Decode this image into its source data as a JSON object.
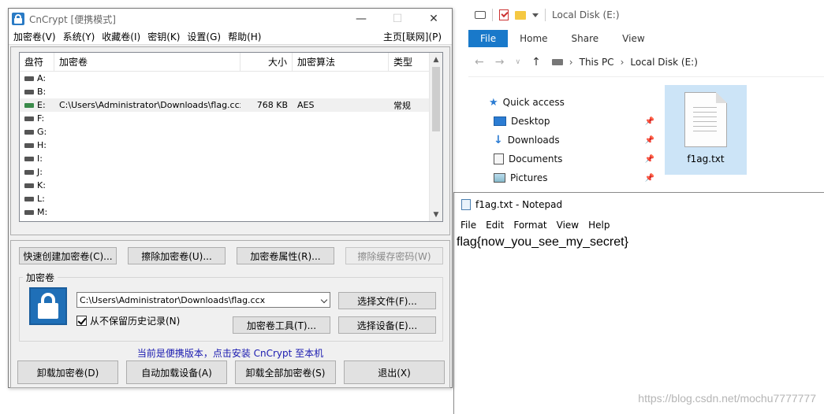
{
  "explorer": {
    "title": "Local Disk (E:)",
    "ribbon_tabs": [
      "File",
      "Home",
      "Share",
      "View"
    ],
    "address": [
      "This PC",
      "Local Disk (E:)"
    ],
    "nav_items": [
      "Quick access",
      "Desktop",
      "Downloads",
      "Documents",
      "Pictures"
    ],
    "file_name": "f1ag.txt"
  },
  "notepad": {
    "title": "f1ag.txt - Notepad",
    "menu": [
      "File",
      "Edit",
      "Format",
      "View",
      "Help"
    ],
    "content": "flag{now_you_see_my_secret}"
  },
  "watermark": "https://blog.csdn.net/mochu7777777",
  "cncrypt": {
    "title": "CnCrypt [便携模式]",
    "menu": [
      "加密卷(V)",
      "系统(Y)",
      "收藏卷(I)",
      "密钥(K)",
      "设置(G)",
      "帮助(H)"
    ],
    "menu_right": "主页[联网](P)",
    "columns": [
      "盘符",
      "加密卷",
      "大小",
      "加密算法",
      "类型"
    ],
    "drives": [
      {
        "letter": "A:",
        "volume": "",
        "size": "",
        "algo": "",
        "type": ""
      },
      {
        "letter": "B:",
        "volume": "",
        "size": "",
        "algo": "",
        "type": ""
      },
      {
        "letter": "E:",
        "volume": "C:\\Users\\Administrator\\Downloads\\flag.ccx",
        "size": "768 KB",
        "algo": "AES",
        "type": "常规"
      },
      {
        "letter": "F:",
        "volume": "",
        "size": "",
        "algo": "",
        "type": ""
      },
      {
        "letter": "G:",
        "volume": "",
        "size": "",
        "algo": "",
        "type": ""
      },
      {
        "letter": "H:",
        "volume": "",
        "size": "",
        "algo": "",
        "type": ""
      },
      {
        "letter": "I:",
        "volume": "",
        "size": "",
        "algo": "",
        "type": ""
      },
      {
        "letter": "J:",
        "volume": "",
        "size": "",
        "algo": "",
        "type": ""
      },
      {
        "letter": "K:",
        "volume": "",
        "size": "",
        "algo": "",
        "type": ""
      },
      {
        "letter": "L:",
        "volume": "",
        "size": "",
        "algo": "",
        "type": ""
      },
      {
        "letter": "M:",
        "volume": "",
        "size": "",
        "algo": "",
        "type": ""
      }
    ],
    "buttons": {
      "quick_create": "快速创建加密卷(C)...",
      "wipe": "擦除加密卷(U)...",
      "properties": "加密卷属性(R)...",
      "wipe_cache": "擦除缓存密码(W)",
      "select_file": "选择文件(F)...",
      "volume_tools": "加密卷工具(T)...",
      "select_device": "选择设备(E)...",
      "dismount": "卸载加密卷(D)",
      "auto_mount": "自动加载设备(A)",
      "dismount_all": "卸载全部加密卷(S)",
      "exit": "退出(X)"
    },
    "volume_group_label": "加密卷",
    "volume_path": "C:\\Users\\Administrator\\Downloads\\flag.ccx",
    "never_save_history": "从不保留历史记录(N)",
    "portable_note": "当前是便携版本，点击安装 CnCrypt 至本机"
  }
}
